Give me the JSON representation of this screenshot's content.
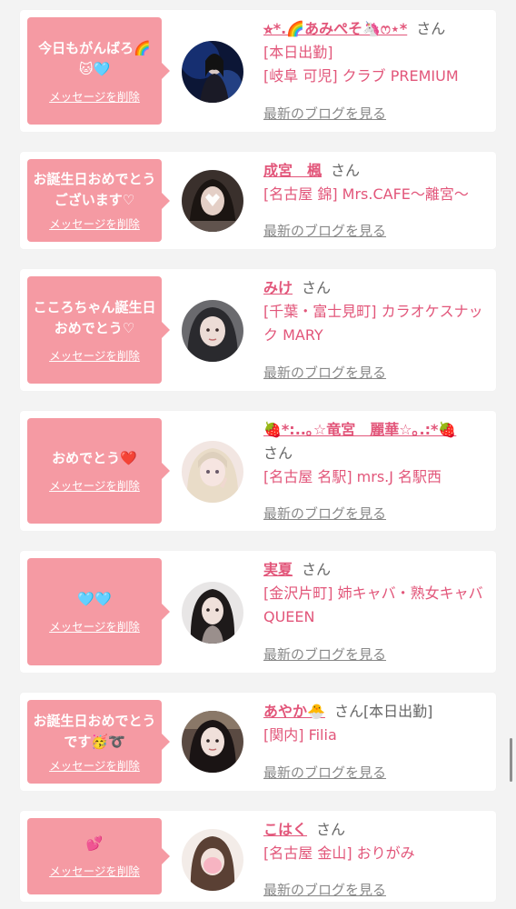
{
  "cards": [
    {
      "message": "今日もがんばろ🌈🐱🩵",
      "delete_label": "メッセージを削除",
      "name": "⭐︎*.🌈あみぺそ🦄ෆ⋆*",
      "san": "さん",
      "lines": [
        "[本日出勤]",
        "[岐阜 可児] クラブ PREMIUM"
      ],
      "blog_label": "最新のブログを見る"
    },
    {
      "message": "お誕生日おめでとうございます♡",
      "delete_label": "メッセージを削除",
      "name": "成宮　楓",
      "san": "さん",
      "lines": [
        "[名古屋 錦] Mrs.CAFE〜離宮〜"
      ],
      "blog_label": "最新のブログを見る"
    },
    {
      "message": "こころちゃん誕生日おめでとう♡",
      "delete_label": "メッセージを削除",
      "name": "みけ",
      "san": "さん",
      "lines": [
        "[千葉・富士見町] カラオケスナック MARY"
      ],
      "blog_label": "最新のブログを見る"
    },
    {
      "message": "おめでとう❤️",
      "delete_label": "メッセージを削除",
      "name": "🍓*:..｡☆竜宮　麗華☆｡.:*🍓",
      "san": "さん",
      "lines": [
        "[名古屋 名駅] mrs.J 名駅西"
      ],
      "blog_label": "最新のブログを見る"
    },
    {
      "message": "🩵🩵",
      "delete_label": "メッセージを削除",
      "name": "実夏",
      "san": "さん",
      "lines": [
        "[金沢片町] 姉キャバ・熟女キャバ QUEEN"
      ],
      "blog_label": "最新のブログを見る"
    },
    {
      "message": "お誕生日おめでとうです🥳➰",
      "delete_label": "メッセージを削除",
      "name": "あやか🐣",
      "san": "さん[本日出勤]",
      "lines": [
        "[関内] Filia"
      ],
      "blog_label": "最新のブログを見る"
    },
    {
      "message": "💕",
      "delete_label": "メッセージを削除",
      "name": "こはく",
      "san": "さん",
      "lines": [
        "[名古屋 金山] おりがみ"
      ],
      "blog_label": "最新のブログを見る"
    }
  ],
  "colors": {
    "bubble": "#f59aa3",
    "name": "#e2567a",
    "page_bg": "#f3f3f3"
  }
}
